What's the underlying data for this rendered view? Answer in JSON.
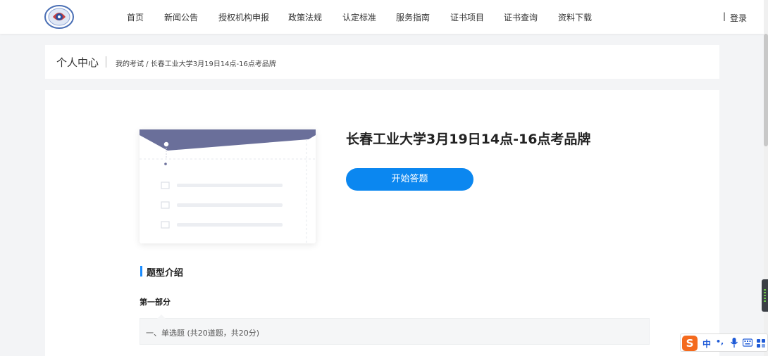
{
  "nav": {
    "items": [
      "首页",
      "新闻公告",
      "授权机构申报",
      "政策法规",
      "认定标准",
      "服务指南",
      "证书项目",
      "证书查询",
      "资料下载"
    ],
    "separator": "|",
    "login": "登录"
  },
  "breadcrumb": {
    "title": "个人中心",
    "path": "我的考试 / 长春工业大学3月19日14点-16点考品牌"
  },
  "exam": {
    "title": "长春工业大学3月19日14点-16点考品牌",
    "start_button": "开始答题"
  },
  "intro": {
    "section_title": "题型介绍",
    "part_title": "第一部分",
    "question_type": "一、单选题 (共20道题，共20分)"
  },
  "ime": {
    "logo": "S",
    "lang": "中",
    "punct": "•,"
  },
  "colors": {
    "primary": "#0b87f0",
    "accent_bar": "#1a8cff",
    "illustration_header": "#6a6f9a",
    "ime_orange": "#f46a1d"
  },
  "icons": [
    "logo-emblem",
    "microphone-icon",
    "keyboard-icon",
    "apps-grid-icon"
  ]
}
